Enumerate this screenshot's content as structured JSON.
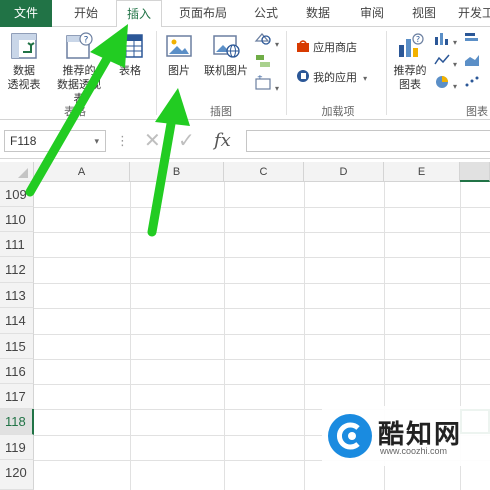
{
  "tabs": [
    {
      "label": "文件",
      "id": "file"
    },
    {
      "label": "开始",
      "id": "home"
    },
    {
      "label": "插入",
      "id": "insert",
      "active": true
    },
    {
      "label": "页面布局",
      "id": "page-layout"
    },
    {
      "label": "公式",
      "id": "formulas"
    },
    {
      "label": "数据",
      "id": "data"
    },
    {
      "label": "审阅",
      "id": "review"
    },
    {
      "label": "视图",
      "id": "view"
    },
    {
      "label": "开发工",
      "id": "developer"
    }
  ],
  "ribbon": {
    "tables_group": {
      "label": "表格",
      "pivot_label_1": "数据",
      "pivot_label_2": "透视表",
      "recommended_pivot_label_1": "推荐的",
      "recommended_pivot_label_2": "数据透视表",
      "table_label": "表格"
    },
    "illustrations_group": {
      "label": "插图",
      "picture_label": "图片",
      "online_picture_label": "联机图片"
    },
    "addins_group": {
      "label": "加载项",
      "store_label": "应用商店",
      "my_apps_label": "我的应用"
    },
    "charts_group": {
      "label": "图表",
      "recommended_charts_label_1": "推荐的",
      "recommended_charts_label_2": "图表"
    }
  },
  "formula_bar": {
    "name_box": "F118",
    "fx": "fx",
    "cancel": "✕",
    "enter": "✓"
  },
  "columns": [
    "A",
    "B",
    "C",
    "D",
    "E"
  ],
  "rows": [
    "109",
    "110",
    "111",
    "112",
    "113",
    "114",
    "115",
    "116",
    "117",
    "118",
    "119",
    "120"
  ],
  "selected_row": "118",
  "watermark": {
    "title": "酷知网",
    "url": "www.coozhi.com"
  },
  "colors": {
    "excel_green": "#217346",
    "arrow_green": "#22cc22",
    "watermark_blue": "#1a8be0"
  }
}
